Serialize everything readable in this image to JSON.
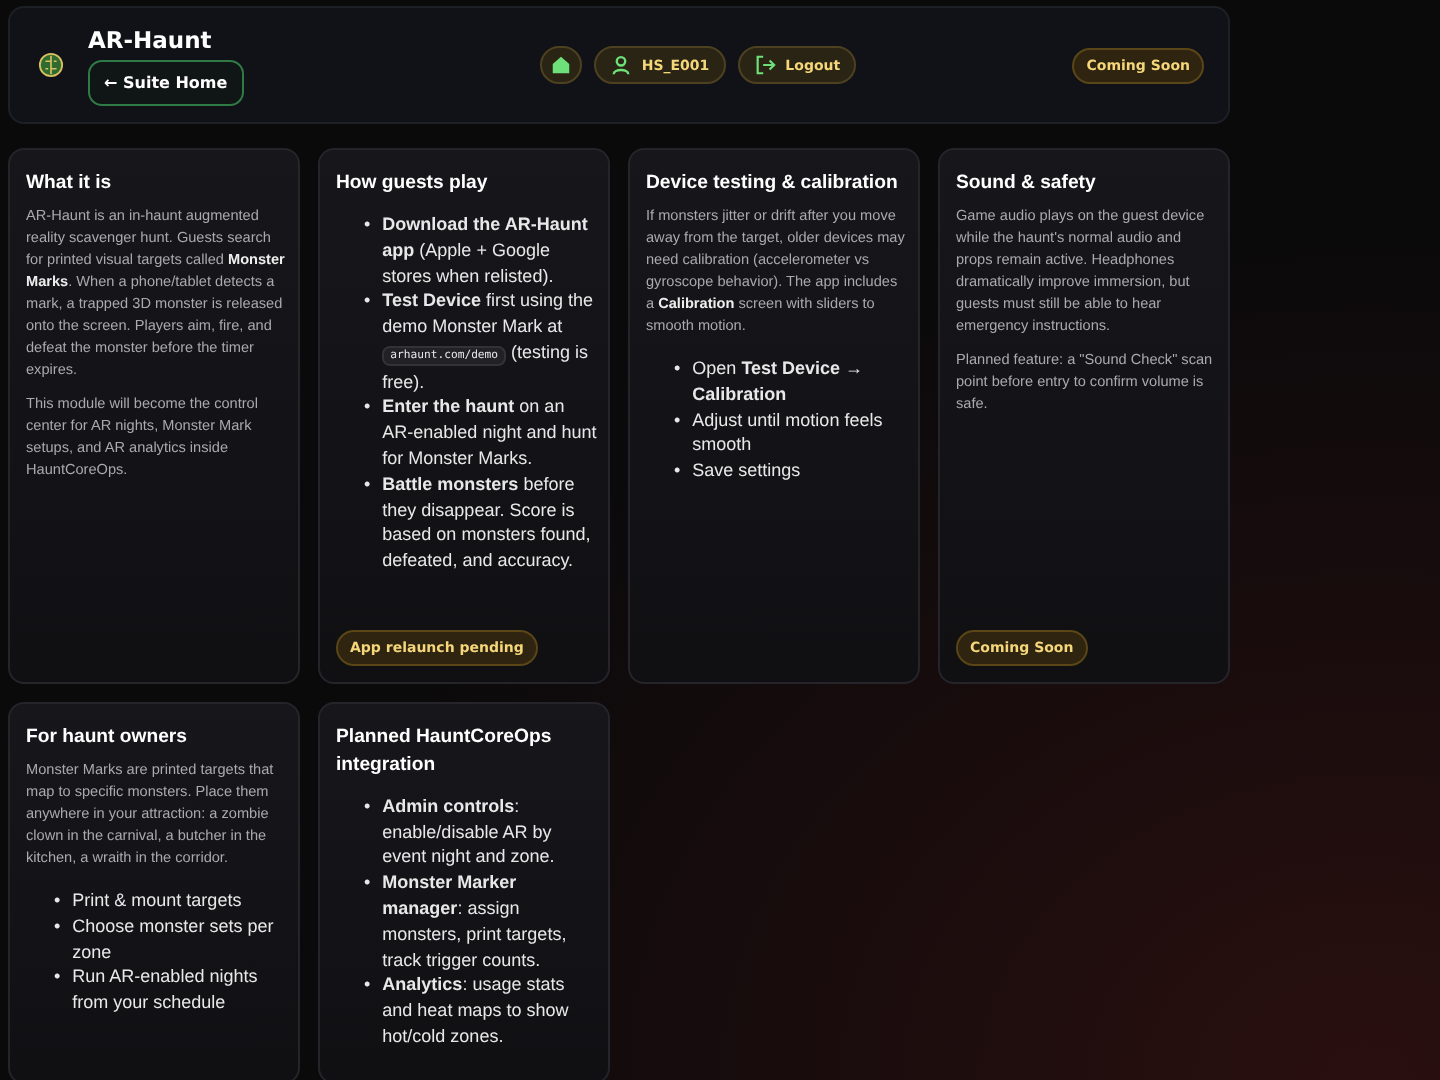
{
  "header": {
    "title": "AR-Haunt",
    "back_button": "← Suite Home",
    "user": "HS_E001",
    "logout": "Logout",
    "status_badge": "Coming Soon"
  },
  "cards": [
    {
      "title": "What it is",
      "paragraphs": [
        "AR-Haunt is an in-haunt augmented reality scavenger hunt. Guests search for printed visual targets called **Monster Marks**. When a phone/tablet detects a mark, a trapped 3D monster is released onto the screen. Players aim, fire, and defeat the monster before the timer expires.",
        "This module will become the control center for AR nights, Monster Mark setups, and AR analytics inside HauntCoreOps."
      ]
    },
    {
      "title": "How guests play",
      "bullets": [
        {
          "marker": "•",
          "parts": [
            {
              "kind": "text",
              "text": "**Download the AR-Haunt app** (Apple + Google stores when relisted)."
            }
          ]
        },
        {
          "marker": "•",
          "parts": [
            {
              "kind": "text",
              "text": "**Test Device** first using the demo Monster Mark at "
            },
            {
              "kind": "code",
              "text": "arhaunt.com/demo"
            },
            {
              "kind": "text",
              "text": " (testing is free)."
            }
          ]
        },
        {
          "marker": "•",
          "parts": [
            {
              "kind": "text",
              "text": "**Enter the haunt** on an AR-enabled night and hunt for Monster Marks."
            }
          ]
        },
        {
          "marker": "•",
          "parts": [
            {
              "kind": "text",
              "text": "**Battle monsters** before they disappear. Score is based on monsters found, defeated, and accuracy."
            }
          ]
        }
      ],
      "badge": "App relaunch pending"
    },
    {
      "title": "Device testing & calibration",
      "paragraphs": [
        "If monsters jitter or drift after you move away from the target, older devices may need calibration (accelerometer vs gyroscope behavior). The app includes a **Calibration** screen with sliders to smooth motion."
      ],
      "bullets": [
        {
          "marker": "•",
          "parts": [
            {
              "kind": "text",
              "text": "Open **Test Device → Calibration**"
            }
          ]
        },
        {
          "marker": "•",
          "parts": [
            {
              "kind": "text",
              "text": "Adjust until motion feels smooth"
            }
          ]
        },
        {
          "marker": "•",
          "parts": [
            {
              "kind": "text",
              "text": "Save settings"
            }
          ]
        }
      ]
    },
    {
      "title": "Sound & safety",
      "paragraphs": [
        "Game audio plays on the guest device while the haunt's normal audio and props remain active. Headphones dramatically improve immersion, but guests must still be able to hear emergency instructions.",
        "Planned feature: a \"Sound Check\" scan point before entry to confirm volume is safe."
      ],
      "badge": "Coming Soon"
    },
    {
      "title": "For haunt owners",
      "paragraphs": [
        "Monster Marks are printed targets that map to specific monsters. Place them anywhere in your attraction: a zombie clown in the carnival, a butcher in the kitchen, a wraith in the corridor."
      ],
      "bullets": [
        {
          "marker": "•",
          "parts": [
            {
              "kind": "text",
              "text": "Print & mount targets"
            }
          ]
        },
        {
          "marker": "•",
          "parts": [
            {
              "kind": "text",
              "text": "Choose monster sets per zone"
            }
          ]
        },
        {
          "marker": "•",
          "parts": [
            {
              "kind": "text",
              "text": "Run AR-enabled nights from your schedule"
            }
          ]
        }
      ]
    },
    {
      "title": "Planned HauntCoreOps integration",
      "bullets": [
        {
          "marker": "•",
          "parts": [
            {
              "kind": "text",
              "text": "**Admin controls**: enable/disable AR by event night and zone."
            }
          ]
        },
        {
          "marker": "•",
          "parts": [
            {
              "kind": "text",
              "text": "**Monster Marker manager**: assign monsters, print targets, track trigger counts."
            }
          ]
        },
        {
          "marker": "•",
          "parts": [
            {
              "kind": "text",
              "text": "**Analytics**: usage stats and heat maps to show hot/cold zones."
            }
          ]
        }
      ]
    }
  ]
}
